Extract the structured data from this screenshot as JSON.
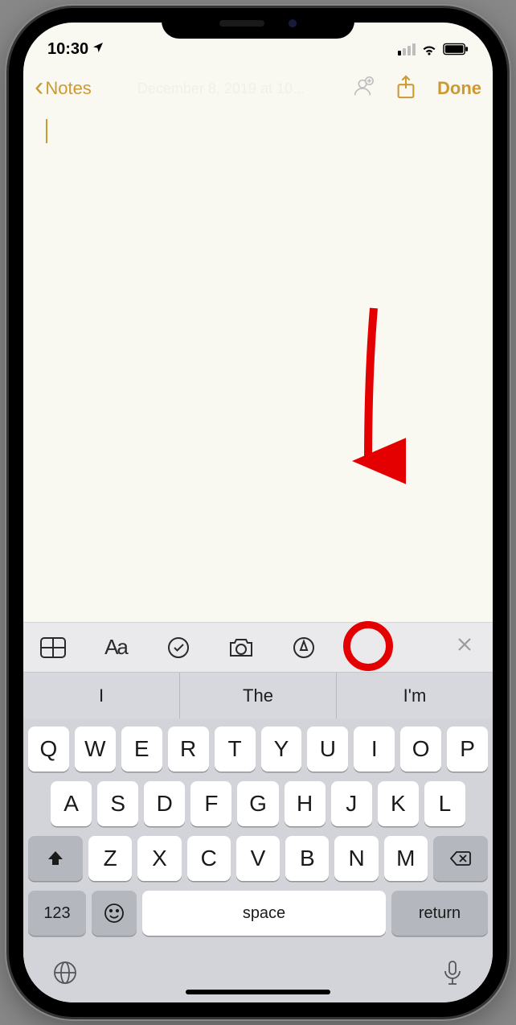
{
  "statusBar": {
    "time": "10:30",
    "locationServices": true
  },
  "nav": {
    "backLabel": "Notes",
    "ghostDate": "December 8, 2019 at 10...",
    "doneLabel": "Done"
  },
  "toolbar": {
    "items": [
      "table",
      "text-format",
      "checklist",
      "camera",
      "markup"
    ],
    "closeLabel": "×"
  },
  "predictive": {
    "left": "I",
    "middle": "The",
    "right": "I'm"
  },
  "keyboard": {
    "row1": [
      "Q",
      "W",
      "E",
      "R",
      "T",
      "Y",
      "U",
      "I",
      "O",
      "P"
    ],
    "row2": [
      "A",
      "S",
      "D",
      "F",
      "G",
      "H",
      "J",
      "K",
      "L"
    ],
    "row3": [
      "Z",
      "X",
      "C",
      "V",
      "B",
      "N",
      "M"
    ],
    "numLabel": "123",
    "spaceLabel": "space",
    "returnLabel": "return"
  },
  "annotation": {
    "highlightTarget": "markup-icon"
  }
}
